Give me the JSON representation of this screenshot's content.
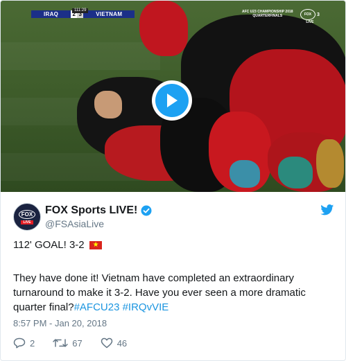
{
  "video": {
    "scoreboard": {
      "home_team": "IRAQ",
      "home_score": "2",
      "away_score": "3",
      "away_team": "VIETNAM",
      "clock": "111:29"
    },
    "tournament_line1": "AFC U23 CHAMPIONSHIP 2018",
    "tournament_line2": "QUARTERFINALS",
    "channel_logo": "FOX",
    "channel_number": "3",
    "channel_sub": "LIVE",
    "play_icon": "play-icon"
  },
  "tweet": {
    "avatar_text": "FOX",
    "avatar_sub": "LIVE",
    "display_name": "FOX Sports LIVE!",
    "handle": "@FSAsiaLive",
    "verified_icon": "verified-badge-icon",
    "brand_icon": "twitter-bird-icon",
    "headline": "112' GOAL! 3-2",
    "headline_emoji": "vietnam-flag",
    "body_text": "They have done it! Vietnam have completed an extraordinary turnaround to make it 3-2. Have you ever seen a more dramatic quarter final?",
    "hashtag1": "#AFCU23",
    "hashtag2": "#IRQvVIE",
    "timestamp": "8:57 PM - Jan 20, 2018",
    "replies": "2",
    "retweets": "67",
    "likes": "46",
    "accent_color": "#1da1f2"
  }
}
